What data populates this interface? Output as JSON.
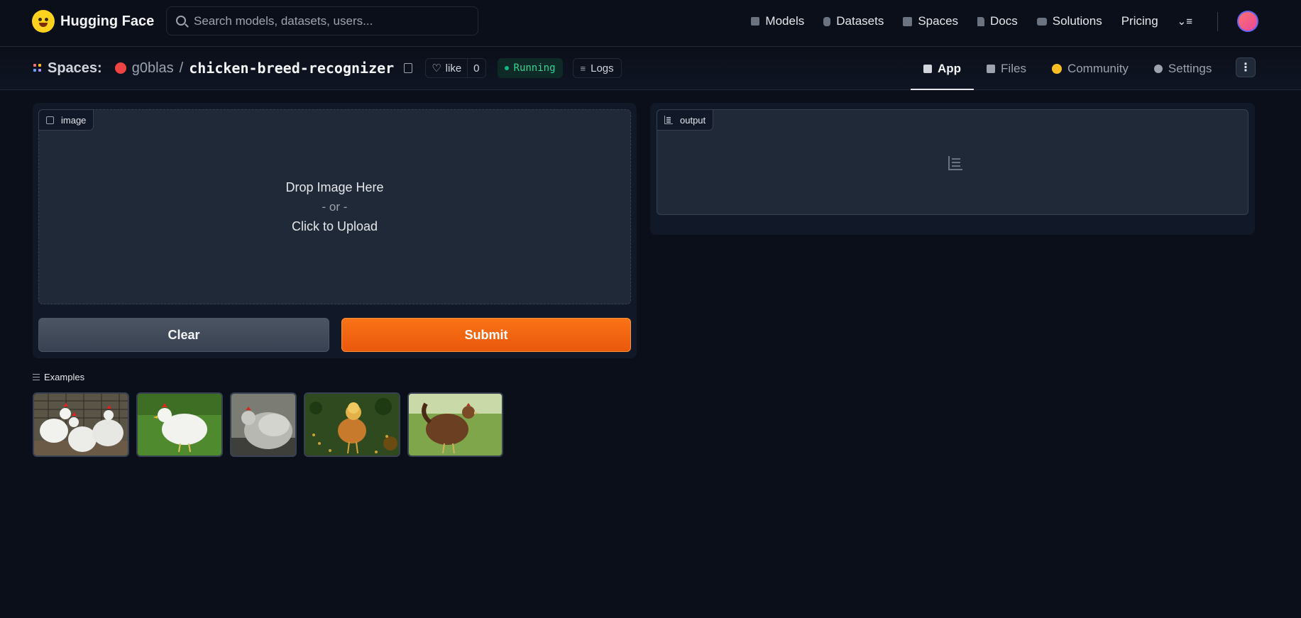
{
  "topnav": {
    "brand": "Hugging Face",
    "search_placeholder": "Search models, datasets, users...",
    "links": [
      "Models",
      "Datasets",
      "Spaces",
      "Docs",
      "Solutions",
      "Pricing"
    ]
  },
  "space": {
    "section_label": "Spaces:",
    "owner": "g0blas",
    "separator": "/",
    "repo": "chicken-breed-recognizer",
    "like_label": "like",
    "like_count": "0",
    "status": "Running",
    "logs_label": "Logs",
    "tabs": [
      "App",
      "Files",
      "Community",
      "Settings"
    ],
    "active_tab": "App"
  },
  "input": {
    "label": "image",
    "drop_text": "Drop Image Here",
    "or_text": "- or -",
    "upload_text": "Click to Upload"
  },
  "output": {
    "label": "output"
  },
  "buttons": {
    "clear": "Clear",
    "submit": "Submit"
  },
  "examples": {
    "label": "Examples",
    "thumbnails": [
      "example-1",
      "example-2",
      "example-3",
      "example-4",
      "example-5"
    ]
  },
  "colors": {
    "background": "#0b0f19",
    "panel": "#111827",
    "block": "#1f2937",
    "accent": "#f97316",
    "status": "#10b981"
  }
}
